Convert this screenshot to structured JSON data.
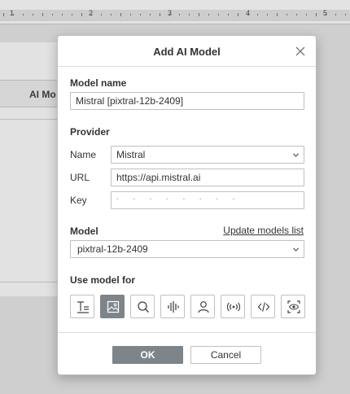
{
  "ruler": {
    "numbers": [
      "1",
      "2",
      "3",
      "4",
      "5"
    ]
  },
  "background": {
    "panel_header": "AI Mo"
  },
  "dialog": {
    "title": "Add AI Model",
    "model_name": {
      "label": "Model name",
      "value": "Mistral [pixtral-12b-2409]"
    },
    "provider": {
      "label": "Provider",
      "name_label": "Name",
      "name_value": "Mistral",
      "url_label": "URL",
      "url_value": "https://api.mistral.ai",
      "key_label": "Key",
      "key_value": "• • • • • • • •"
    },
    "model": {
      "label": "Model",
      "update_link": "Update models list",
      "selected": "pixtral-12b-2409"
    },
    "use_for": {
      "label": "Use model for",
      "icons": [
        "text-icon",
        "image-icon",
        "search-icon",
        "audio-icon",
        "person-icon",
        "broadcast-icon",
        "code-icon",
        "vision-icon"
      ],
      "active_index": 1
    },
    "ok_label": "OK",
    "cancel_label": "Cancel"
  },
  "colors": {
    "active_button": "#7d858a",
    "backdrop": "#cfcfcf"
  }
}
